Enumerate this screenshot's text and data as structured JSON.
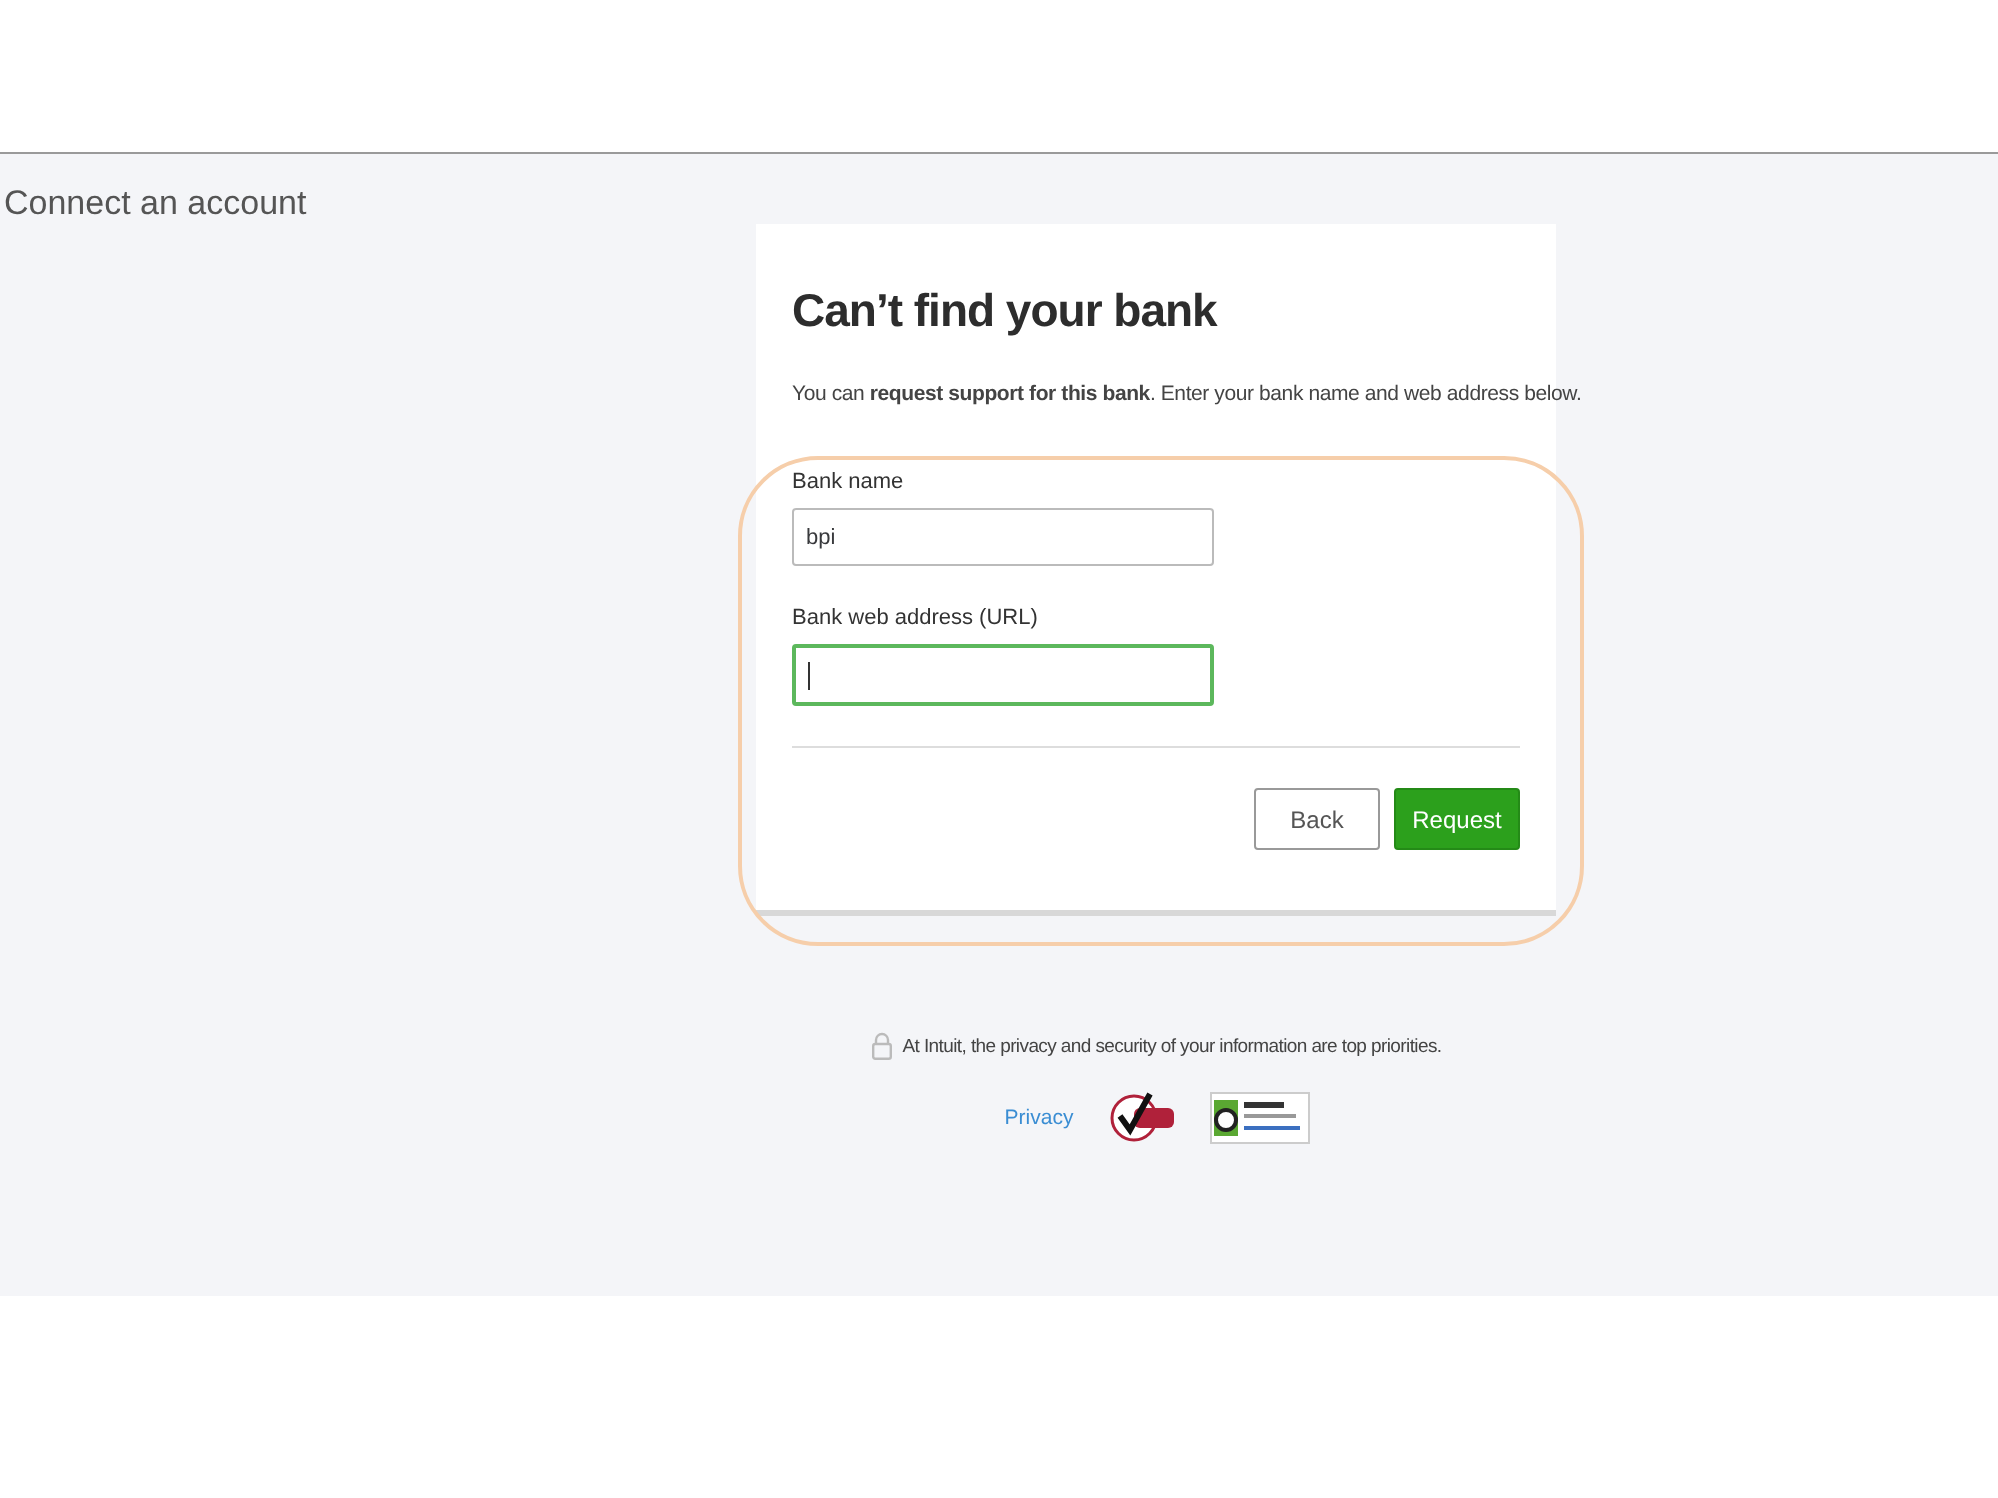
{
  "page": {
    "title": "Connect an account"
  },
  "card": {
    "heading": "Can’t find your bank",
    "intro": "You can **request support for this bank**. Enter your bank name and web address below.",
    "fields": [
      {
        "label": "Bank name",
        "value": "bpi",
        "focused": false
      },
      {
        "label": "Bank web address (URL)",
        "focused": true
      }
    ],
    "buttons": [
      {
        "label": "Back",
        "kind": "secondary"
      },
      {
        "label": "Request",
        "kind": "primary"
      }
    ]
  },
  "footer": {
    "security_note": "At Intuit, the privacy and security of your information are top priorities.",
    "privacy_link": "Privacy"
  }
}
